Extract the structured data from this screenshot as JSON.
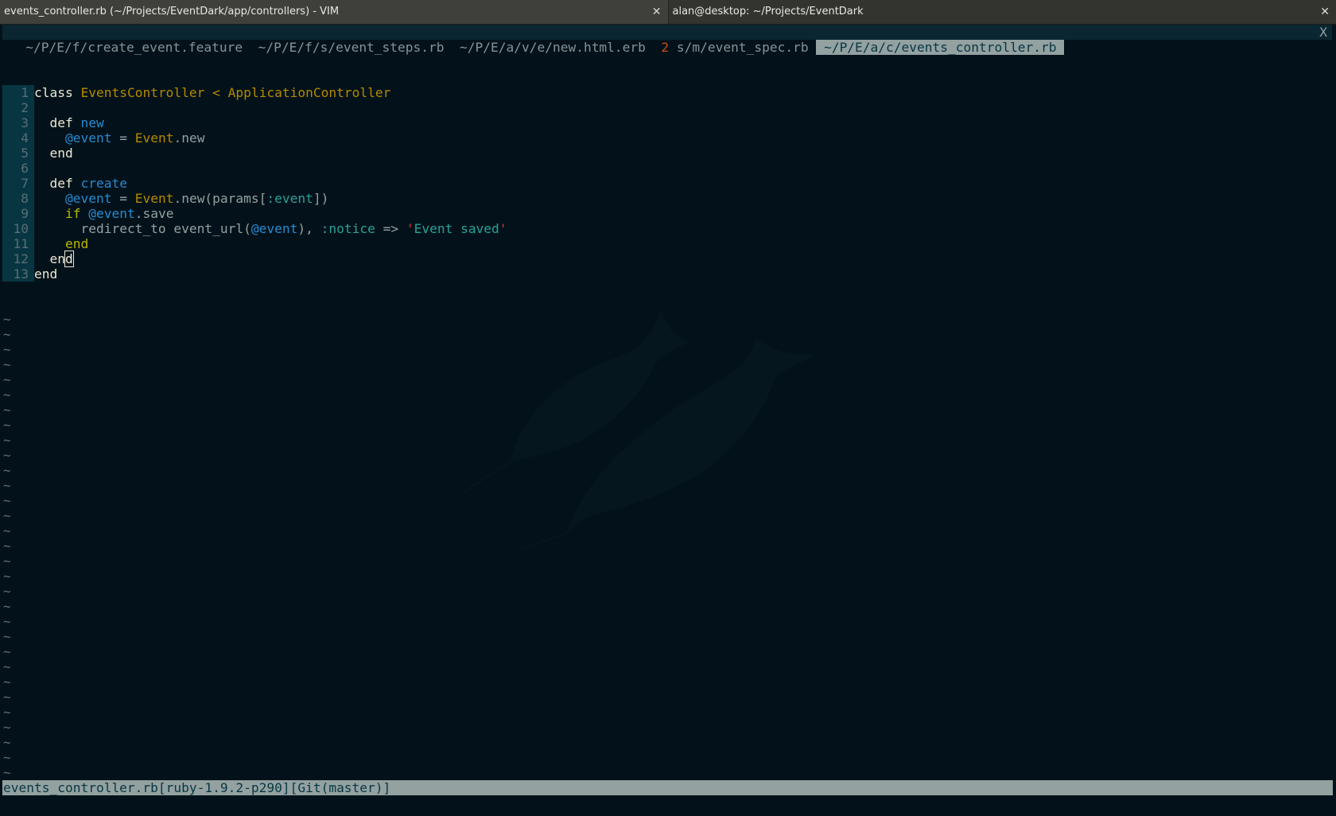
{
  "window_tabs": [
    {
      "title": "events_controller.rb (~/Projects/EventDark/app/controllers) - VIM",
      "close": "✕"
    },
    {
      "title": "alan@desktop: ~/Projects/EventDark",
      "close": "✕"
    }
  ],
  "vim_tabs": [
    {
      "prefix": "",
      "label": " ~/P/E/f/create_event.feature ",
      "selected": false
    },
    {
      "prefix": "",
      "label": " ~/P/E/f/s/event_steps.rb ",
      "selected": false
    },
    {
      "prefix": "",
      "label": " ~/P/E/a/v/e/new.html.erb ",
      "selected": false
    },
    {
      "prefix": " 2",
      "label": " s/m/event_spec.rb ",
      "selected": false
    },
    {
      "prefix": "",
      "label": " ~/P/E/a/c/events_controller.rb ",
      "selected": true
    }
  ],
  "tabline_close": "X",
  "code_lines": [
    {
      "n": "1",
      "tokens": [
        {
          "t": "class",
          "c": "k"
        },
        {
          "t": " ",
          "c": ""
        },
        {
          "t": "EventsController",
          "c": "cn"
        },
        {
          "t": " < ",
          "c": "cn"
        },
        {
          "t": "ApplicationController",
          "c": "cn"
        }
      ]
    },
    {
      "n": "2",
      "tokens": []
    },
    {
      "n": "3",
      "tokens": [
        {
          "t": "  ",
          "c": ""
        },
        {
          "t": "def",
          "c": "k"
        },
        {
          "t": " ",
          "c": ""
        },
        {
          "t": "new",
          "c": "fn"
        }
      ]
    },
    {
      "n": "4",
      "tokens": [
        {
          "t": "    ",
          "c": ""
        },
        {
          "t": "@event",
          "c": "iv"
        },
        {
          "t": " = ",
          "c": ""
        },
        {
          "t": "Event",
          "c": "cn"
        },
        {
          "t": ".new",
          "c": ""
        }
      ]
    },
    {
      "n": "5",
      "tokens": [
        {
          "t": "  ",
          "c": ""
        },
        {
          "t": "end",
          "c": "k"
        }
      ]
    },
    {
      "n": "6",
      "tokens": []
    },
    {
      "n": "7",
      "tokens": [
        {
          "t": "  ",
          "c": ""
        },
        {
          "t": "def",
          "c": "k"
        },
        {
          "t": " ",
          "c": ""
        },
        {
          "t": "create",
          "c": "fn"
        }
      ]
    },
    {
      "n": "8",
      "tokens": [
        {
          "t": "    ",
          "c": ""
        },
        {
          "t": "@event",
          "c": "iv"
        },
        {
          "t": " = ",
          "c": ""
        },
        {
          "t": "Event",
          "c": "cn"
        },
        {
          "t": ".new(params[",
          "c": ""
        },
        {
          "t": ":event",
          "c": "sym"
        },
        {
          "t": "])",
          "c": ""
        }
      ]
    },
    {
      "n": "9",
      "tokens": [
        {
          "t": "    ",
          "c": ""
        },
        {
          "t": "if",
          "c": "kd"
        },
        {
          "t": " ",
          "c": ""
        },
        {
          "t": "@event",
          "c": "iv"
        },
        {
          "t": ".save",
          "c": ""
        }
      ]
    },
    {
      "n": "10",
      "tokens": [
        {
          "t": "      redirect_to event_url(",
          "c": ""
        },
        {
          "t": "@event",
          "c": "iv"
        },
        {
          "t": "), ",
          "c": ""
        },
        {
          "t": ":notice",
          "c": "sym"
        },
        {
          "t": " => ",
          "c": ""
        },
        {
          "t": "'",
          "c": "q"
        },
        {
          "t": "Event saved",
          "c": "str"
        },
        {
          "t": "'",
          "c": "q"
        }
      ]
    },
    {
      "n": "11",
      "tokens": [
        {
          "t": "    ",
          "c": ""
        },
        {
          "t": "end",
          "c": "kd"
        }
      ]
    },
    {
      "n": "12",
      "tokens": [
        {
          "t": "  ",
          "c": ""
        },
        {
          "t": "en",
          "c": "k"
        },
        {
          "t": "d",
          "c": "k cursor"
        }
      ]
    },
    {
      "n": "13",
      "tokens": [
        {
          "t": "end",
          "c": "k"
        }
      ]
    }
  ],
  "empty_line_marker": "~",
  "empty_line_count": 36,
  "status_line": "events_controller.rb[ruby-1.9.2-p290][Git(master)]",
  "colors": {
    "background": "#03121a",
    "gutter": "#073642",
    "status_bg": "#93a1a1",
    "constant": "#b58900",
    "function": "#268bd2",
    "string": "#2aa198"
  }
}
